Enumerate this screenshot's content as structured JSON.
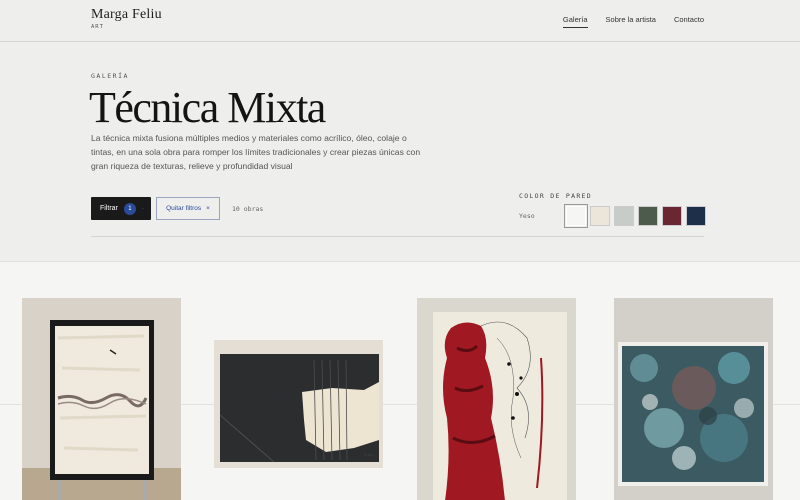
{
  "brand": {
    "name": "Marga Feliu",
    "sub": "ART"
  },
  "nav": {
    "items": [
      "Galería",
      "Sobre la artista",
      "Contacto"
    ]
  },
  "hero": {
    "eyebrow": "GALERÍA",
    "title": "Técnica Mixta",
    "description": "La técnica mixta fusiona múltiples medios y materiales como acrílico, óleo, colaje o tintas, en una sola obra para romper los límites tradicionales y crear piezas únicas con gran riqueza de texturas, relieve y profundidad visual"
  },
  "controls": {
    "filter_label": "Filtrar",
    "filter_count": "1",
    "filter_dot": "·",
    "clear_label": "Quitar filtros",
    "clear_icon": "×",
    "count_text": "10 obras"
  },
  "wall": {
    "title": "COLOR DE PARED",
    "value": "Yeso",
    "swatches": [
      "#f5f5f3",
      "#ece6da",
      "#c8ccc9",
      "#4c5b4c",
      "#6b2731",
      "#1e3049"
    ]
  },
  "artworks": [
    {
      "name": "artwork-1"
    },
    {
      "name": "artwork-2"
    },
    {
      "name": "artwork-3"
    },
    {
      "name": "artwork-4"
    }
  ]
}
